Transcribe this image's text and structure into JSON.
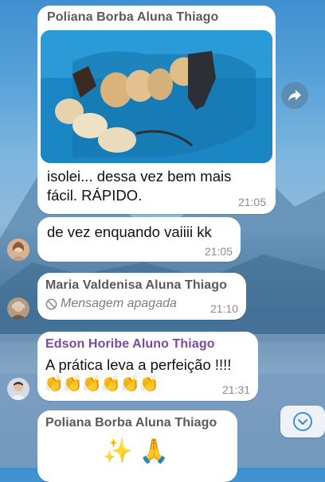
{
  "messages": [
    {
      "sender": "Poliana Borba Aluna Thiago",
      "text_line1": "isolei... dessa vez bem mais",
      "text_line2": "fácil. RÁPIDO.",
      "time": "21:05"
    },
    {
      "text": "de vez enquando vaiiii kk",
      "time": "21:05"
    },
    {
      "sender": "Maria Valdenisa Aluna Thiago",
      "deleted_text": "Mensagem apagada",
      "time": "21:10"
    },
    {
      "sender": "Edson Horibe Aluno Thiago",
      "text": "A prática leva a perfeição !!!!",
      "emojis": "👏👏👏👏👏👏",
      "time": "21:31"
    },
    {
      "sender": "Poliana Borba Aluna Thiago",
      "emojis": "✨ 🙏"
    }
  ],
  "colors": {
    "sender_gray": "#5a5a5a",
    "sender_purple": "#7b4aa0",
    "timestamp": "#8c8c8c",
    "bubble": "#ffffff"
  },
  "icons": {
    "forward": "share-arrow-icon",
    "deleted": "blocked-circle-icon",
    "scroll_down": "chevron-down-icon"
  }
}
